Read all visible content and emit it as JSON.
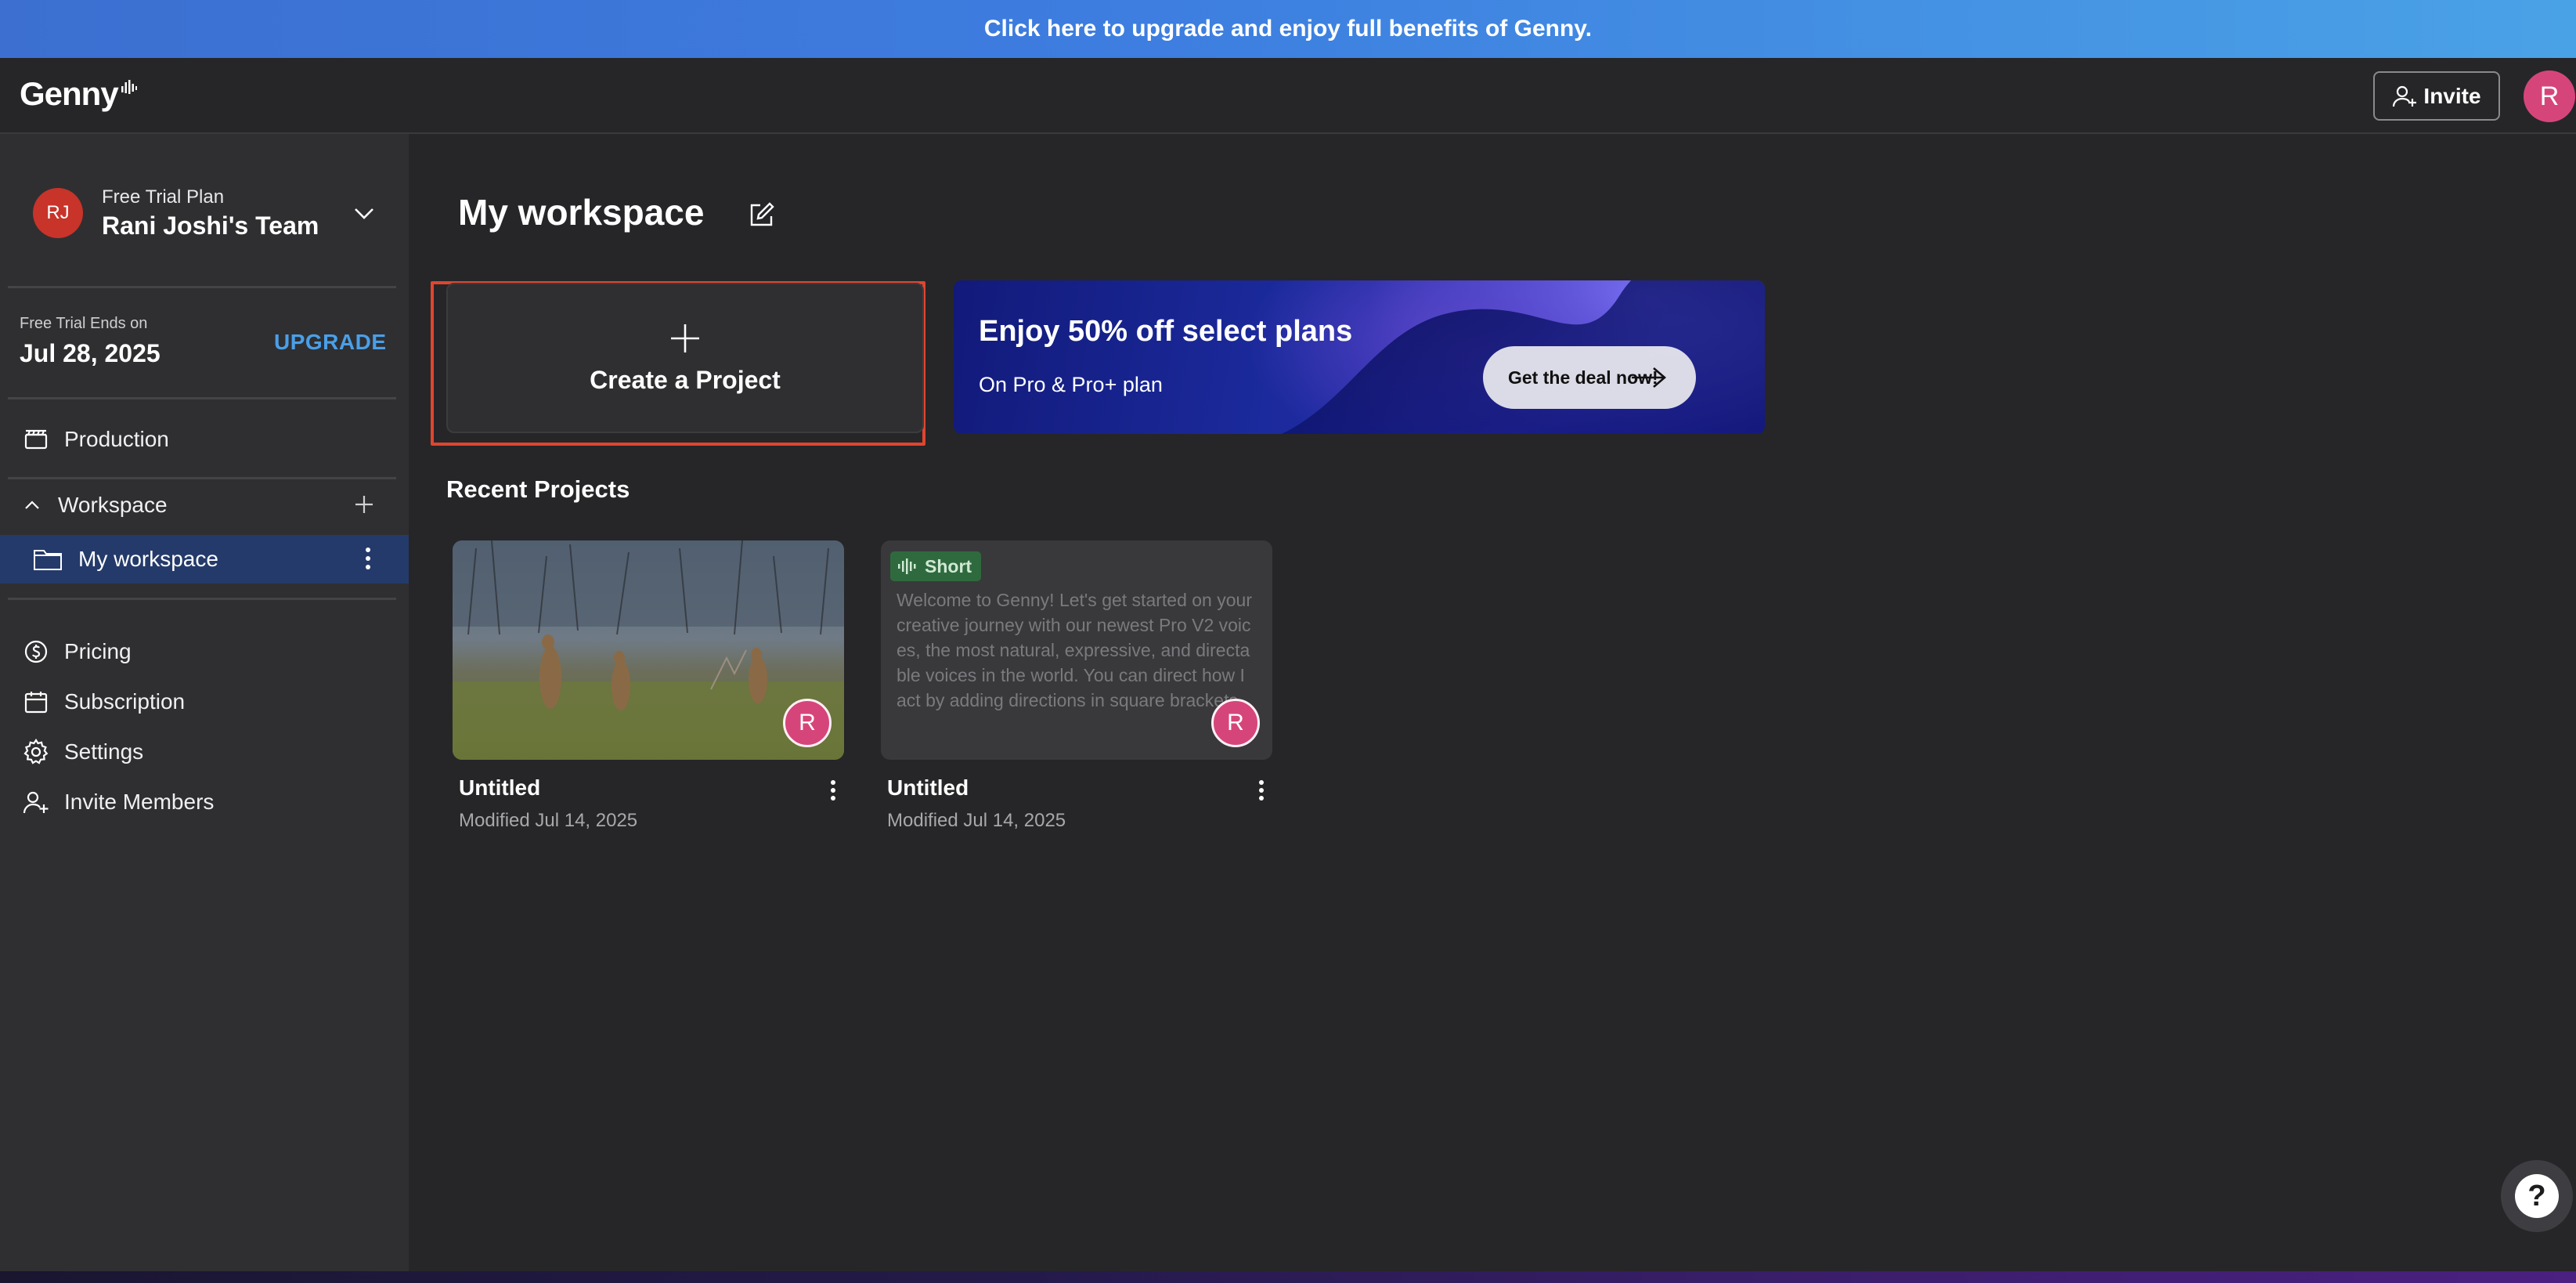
{
  "banner": {
    "text": "Click here to upgrade and enjoy full benefits of Genny."
  },
  "topbar": {
    "logo": "Genny",
    "invite_label": "Invite",
    "avatar_initial": "R"
  },
  "sidebar": {
    "team": {
      "plan": "Free Trial Plan",
      "name": "Rani Joshi's Team",
      "initials": "RJ"
    },
    "trial": {
      "label": "Free Trial Ends on",
      "date": "Jul 28, 2025",
      "upgrade_label": "UPGRADE"
    },
    "production_label": "Production",
    "workspace_label": "Workspace",
    "active_workspace": "My workspace",
    "items": [
      {
        "label": "Pricing",
        "icon": "dollar-icon"
      },
      {
        "label": "Subscription",
        "icon": "calendar-icon"
      },
      {
        "label": "Settings",
        "icon": "gear-icon"
      },
      {
        "label": "Invite Members",
        "icon": "add-user-icon"
      }
    ]
  },
  "main": {
    "title": "My workspace",
    "create_label": "Create a Project",
    "promo": {
      "title": "Enjoy 50% off select plans",
      "subtitle": "On Pro & Pro+ plan",
      "button": "Get the deal now!"
    },
    "recent_title": "Recent Projects",
    "projects": [
      {
        "name": "Untitled",
        "modified": "Modified Jul 14, 2025",
        "avatar": "R",
        "type": "image"
      },
      {
        "name": "Untitled",
        "modified": "Modified Jul 14, 2025",
        "avatar": "R",
        "type": "text",
        "badge": "Short",
        "preview": "Welcome to Genny! Let's get started on your creative journey with our newest Pro V2 voices, the most natural, expressive, and directable voices in the world. You can direct how I act by adding directions in square brackets"
      }
    ]
  },
  "help_label": "?",
  "colors": {
    "accent": "#4a9fe8",
    "avatar": "#d6457a",
    "active_nav": "#243a6a",
    "highlight": "#e0452f"
  }
}
